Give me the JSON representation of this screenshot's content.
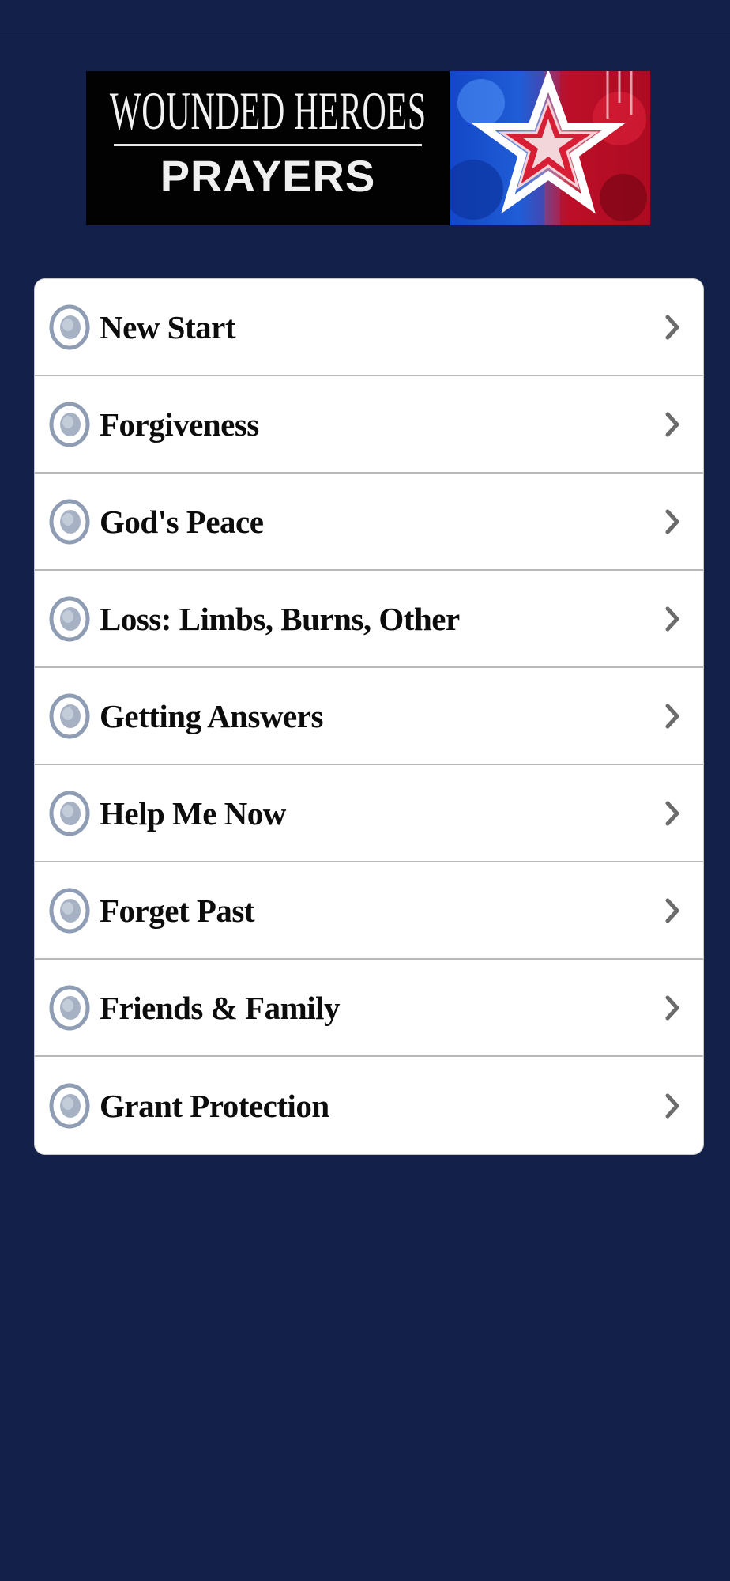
{
  "banner": {
    "title_top": "WOUNDED HEROES",
    "title_bottom": "PRAYERS"
  },
  "menu": {
    "items": [
      {
        "label": "New Start",
        "icon": "ring-bullet-icon"
      },
      {
        "label": "Forgiveness",
        "icon": "ring-bullet-icon"
      },
      {
        "label": "God's Peace",
        "icon": "ring-bullet-icon"
      },
      {
        "label": "Loss: Limbs, Burns, Other",
        "icon": "ring-bullet-icon"
      },
      {
        "label": "Getting Answers",
        "icon": "ring-bullet-icon"
      },
      {
        "label": "Help Me Now",
        "icon": "ring-bullet-icon"
      },
      {
        "label": "Forget Past",
        "icon": "ring-bullet-icon"
      },
      {
        "label": "Friends & Family",
        "icon": "ring-bullet-icon"
      },
      {
        "label": "Grant Protection",
        "icon": "ring-bullet-icon"
      }
    ]
  },
  "colors": {
    "background": "#13214a",
    "card": "#ffffff",
    "text": "#0c0c0c",
    "chevron": "#6b6b6b",
    "icon": "#8e9db3"
  }
}
